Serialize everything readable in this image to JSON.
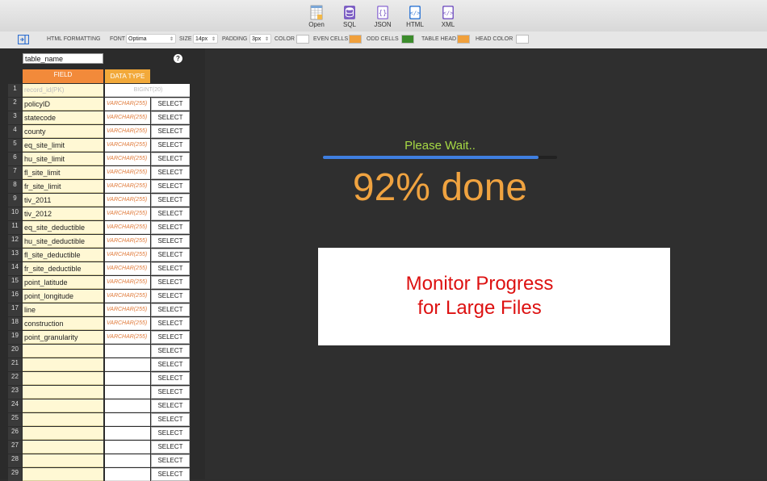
{
  "toolbar": {
    "items": [
      {
        "label": "Open",
        "icon": "open-grid-icon"
      },
      {
        "label": "SQL",
        "icon": "sql-database-icon"
      },
      {
        "label": "JSON",
        "icon": "json-braces-icon"
      },
      {
        "label": "HTML",
        "icon": "html-code-icon"
      },
      {
        "label": "XML",
        "icon": "xml-code-icon"
      }
    ]
  },
  "format_bar": {
    "title": "HTML FORMATTING",
    "font_label": "FONT",
    "font_value": "Optima",
    "size_label": "SIZE",
    "size_value": "14px",
    "padding_label": "PADDING",
    "padding_value": "3px",
    "color_label": "COLOR",
    "color_value": "#ffffff",
    "even_cells_label": "EVEN CELLS",
    "even_cells_color": "#f0a03c",
    "odd_cells_label": "ODD CELLS",
    "odd_cells_color": "#3c8c2c",
    "table_head_label": "TABLE HEAD",
    "table_head_color": "#f0a03c",
    "head_color_label": "HEAD COLOR",
    "head_color_value": "#ffffff"
  },
  "schema": {
    "table_name": "table_name",
    "help": "?",
    "header_field": "FIELD",
    "header_type": "DATA TYPE",
    "rows": [
      {
        "num": "1",
        "field": "record_id(PK)",
        "type": "BIGINT(20)",
        "select": ""
      },
      {
        "num": "2",
        "field": "policyID",
        "type": "VARCHAR(255)",
        "select": "SELECT"
      },
      {
        "num": "3",
        "field": "statecode",
        "type": "VARCHAR(255)",
        "select": "SELECT"
      },
      {
        "num": "4",
        "field": "county",
        "type": "VARCHAR(255)",
        "select": "SELECT"
      },
      {
        "num": "5",
        "field": "eq_site_limit",
        "type": "VARCHAR(255)",
        "select": "SELECT"
      },
      {
        "num": "6",
        "field": "hu_site_limit",
        "type": "VARCHAR(255)",
        "select": "SELECT"
      },
      {
        "num": "7",
        "field": "fl_site_limit",
        "type": "VARCHAR(255)",
        "select": "SELECT"
      },
      {
        "num": "8",
        "field": "fr_site_limit",
        "type": "VARCHAR(255)",
        "select": "SELECT"
      },
      {
        "num": "9",
        "field": "tiv_2011",
        "type": "VARCHAR(255)",
        "select": "SELECT"
      },
      {
        "num": "10",
        "field": "tiv_2012",
        "type": "VARCHAR(255)",
        "select": "SELECT"
      },
      {
        "num": "11",
        "field": "eq_site_deductible",
        "type": "VARCHAR(255)",
        "select": "SELECT"
      },
      {
        "num": "12",
        "field": "hu_site_deductible",
        "type": "VARCHAR(255)",
        "select": "SELECT"
      },
      {
        "num": "13",
        "field": "fl_site_deductible",
        "type": "VARCHAR(255)",
        "select": "SELECT"
      },
      {
        "num": "14",
        "field": "fr_site_deductible",
        "type": "VARCHAR(255)",
        "select": "SELECT"
      },
      {
        "num": "15",
        "field": "point_latitude",
        "type": "VARCHAR(255)",
        "select": "SELECT"
      },
      {
        "num": "16",
        "field": "point_longitude",
        "type": "VARCHAR(255)",
        "select": "SELECT"
      },
      {
        "num": "17",
        "field": "line",
        "type": "VARCHAR(255)",
        "select": "SELECT"
      },
      {
        "num": "18",
        "field": "construction",
        "type": "VARCHAR(255)",
        "select": "SELECT"
      },
      {
        "num": "19",
        "field": "point_granularity",
        "type": "VARCHAR(255)",
        "select": "SELECT"
      },
      {
        "num": "20",
        "field": "",
        "type": "",
        "select": "SELECT"
      },
      {
        "num": "21",
        "field": "",
        "type": "",
        "select": "SELECT"
      },
      {
        "num": "22",
        "field": "",
        "type": "",
        "select": "SELECT"
      },
      {
        "num": "23",
        "field": "",
        "type": "",
        "select": "SELECT"
      },
      {
        "num": "24",
        "field": "",
        "type": "",
        "select": "SELECT"
      },
      {
        "num": "25",
        "field": "",
        "type": "",
        "select": "SELECT"
      },
      {
        "num": "26",
        "field": "",
        "type": "",
        "select": "SELECT"
      },
      {
        "num": "27",
        "field": "",
        "type": "",
        "select": "SELECT"
      },
      {
        "num": "28",
        "field": "",
        "type": "",
        "select": "SELECT"
      },
      {
        "num": "29",
        "field": "",
        "type": "",
        "select": "SELECT"
      }
    ]
  },
  "progress": {
    "wait_text": "Please Wait..",
    "percent": 92,
    "done_text": "92% done"
  },
  "promo": {
    "line1": "Monitor Progress",
    "line2": "for Large Files"
  }
}
